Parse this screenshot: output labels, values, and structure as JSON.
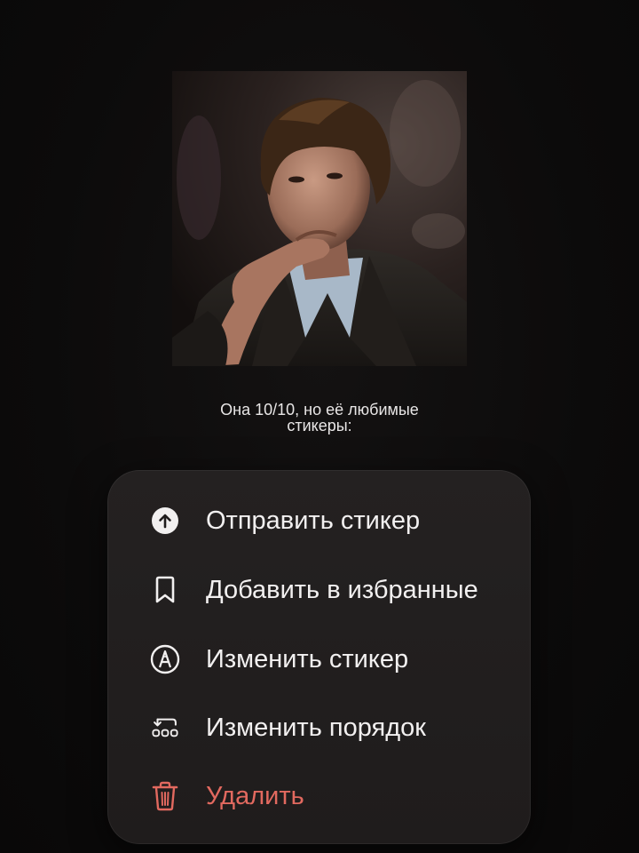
{
  "caption": {
    "line1": "Она 10/10, но её любимые",
    "line2": "стикеры:"
  },
  "photo": {
    "subject": "man-in-dark-suit-portrait"
  },
  "menu": {
    "items": [
      {
        "label": "Отправить стикер",
        "icon": "send-arrow-up-icon"
      },
      {
        "label": "Добавить в избранные",
        "icon": "bookmark-icon"
      },
      {
        "label": "Изменить стикер",
        "icon": "edit-pen-circle-icon"
      },
      {
        "label": "Изменить порядок",
        "icon": "reorder-icon"
      },
      {
        "label": "Удалить",
        "icon": "trash-icon"
      }
    ]
  },
  "colors": {
    "background": "#0b0a0a",
    "menu_bg": "#221f1f",
    "text": "#f2f0f0",
    "danger": "#e2695f"
  }
}
